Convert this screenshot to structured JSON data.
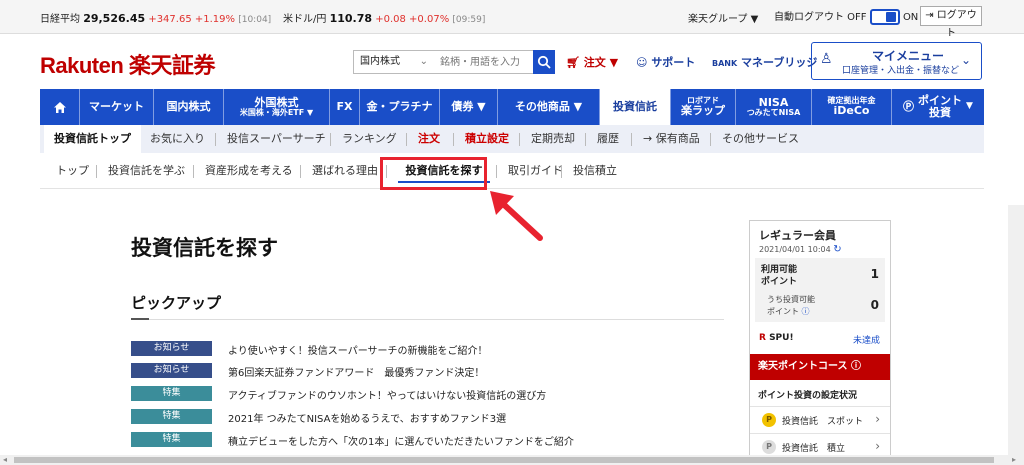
{
  "ticker": {
    "nikkei_label": "日経平均",
    "nikkei_value": "29,526.45",
    "nikkei_change": "+347.65",
    "nikkei_pct": "+1.19%",
    "nikkei_time": "[10:04]",
    "usd_label": "米ドル/円",
    "usd_value": "110.78",
    "usd_change": "+0.08",
    "usd_pct": "+0.07%",
    "usd_time": "[09:59]",
    "group_label": "楽天グループ ▼",
    "autologout_label": "自動ログアウト OFF",
    "autologout_on": "ON",
    "logout_label": "ログアウト"
  },
  "header": {
    "logo": "Rakuten 楽天証券",
    "market_select": "国内株式",
    "search_placeholder": "銘柄・用語を入力",
    "order_label": "注文 ▼",
    "support_label": "サポート",
    "moneybridge_label": "マネーブリッジ",
    "mymenu_title": "マイメニュー",
    "mymenu_sub": "口座管理・入出金・振替など"
  },
  "mainnav": {
    "market": "マーケット",
    "domestic": "国内株式",
    "foreign_l1": "外国株式",
    "foreign_l2": "米国株・海外ETF ▼",
    "fx": "FX",
    "gold": "金・プラチナ",
    "bond": "債券 ▼",
    "other": "その他商品 ▼",
    "fund": "投資信託",
    "robo_l1": "ロボアド",
    "robo_l2": "楽ラップ",
    "nisa_l1": "NISA",
    "nisa_l2": "つみたてNISA",
    "ideco_l1": "確定拠出年金",
    "ideco_l2": "iDeCo",
    "point_l1": "ポイント",
    "point_l2": "投資"
  },
  "subnav": {
    "top": "投資信託トップ",
    "fav": "お気に入り",
    "super": "投信スーパーサーチ",
    "rank": "ランキング",
    "order": "注文",
    "tsumitate": "積立設定",
    "teiki": "定期売却",
    "history": "履歴",
    "holdings": "→ 保有商品",
    "others": "その他サービス"
  },
  "thirdnav": {
    "top": "トップ",
    "learn": "投資信託を学ぶ",
    "asset": "資産形成を考える",
    "reason": "選ばれる理由",
    "find": "投資信託を探す",
    "guide": "取引ガイド",
    "tsumitate": "投信積立"
  },
  "content": {
    "title": "投資信託を探す",
    "pickup": "ピックアップ",
    "news": [
      {
        "badge": "お知らせ",
        "kind": "info",
        "text": "より使いやすく！投信スーパーサーチの新機能をご紹介！"
      },
      {
        "badge": "お知らせ",
        "kind": "info",
        "text": "第6回楽天証券ファンドアワード　最優秀ファンド決定！"
      },
      {
        "badge": "特集",
        "kind": "feat",
        "text": "アクティブファンドのウソホント！やってはいけない投資信託の選び方"
      },
      {
        "badge": "特集",
        "kind": "feat",
        "text": "2021年 つみたてNISAを始めるうえで、おすすめファンド3選"
      },
      {
        "badge": "特集",
        "kind": "feat",
        "text": "積立デビューをした方へ「次の1本」に選んでいただきたいファンドをご紹介"
      }
    ]
  },
  "panel": {
    "member": "レギュラー会員",
    "date": "2021/04/01 10:04",
    "usable_l1": "利用可能",
    "usable_l2": "ポイント",
    "usable_val": "1",
    "invest_l1": "うち投資可能",
    "invest_l2": "ポイント",
    "invest_val": "0",
    "spu": "SPU!",
    "spu_r": "R",
    "spu_status": "未達成",
    "course": "楽天ポイントコース",
    "settings": "ポイント投資の設定状況",
    "row1": "投資信託　スポット",
    "row2": "投資信託　積立"
  }
}
